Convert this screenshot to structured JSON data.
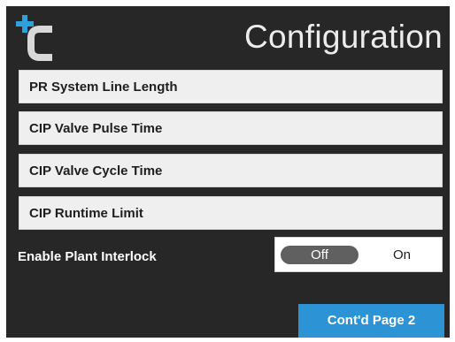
{
  "header": {
    "logo_icon": "brand-logo-icon",
    "title": "Configuration"
  },
  "menu": {
    "items": [
      {
        "label": "PR System Line Length"
      },
      {
        "label": "CIP Valve Pulse Time"
      },
      {
        "label": "CIP Valve Cycle Time"
      },
      {
        "label": "CIP Runtime Limit"
      }
    ]
  },
  "interlock": {
    "label": "Enable Plant Interlock",
    "off_label": "Off",
    "on_label": "On",
    "selected": "Off"
  },
  "footer": {
    "next_label": "Cont'd Page 2"
  },
  "colors": {
    "background": "#272727",
    "item_background": "#efefef",
    "toggle_active": "#606060",
    "button_accent": "#2c93d4",
    "logo_light": "#d8d8d8",
    "logo_accent": "#2ea0dc"
  }
}
